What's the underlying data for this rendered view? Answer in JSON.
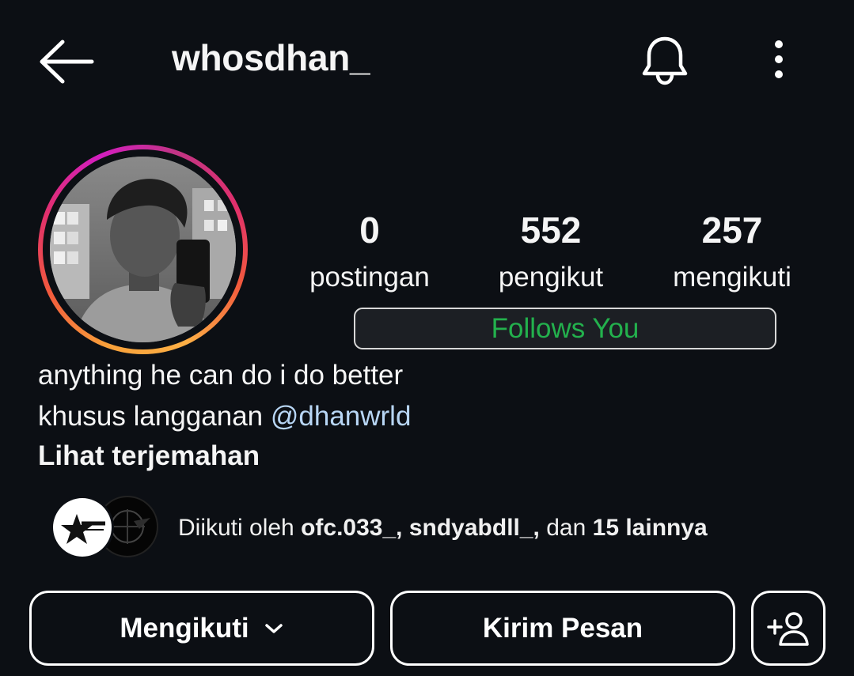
{
  "header": {
    "username": "whosdhan_",
    "back_icon": "arrow-left-icon",
    "notification_icon": "bell-icon",
    "menu_icon": "more-vertical-icon"
  },
  "profile": {
    "avatar_icon": "profile-photo",
    "story_ring_colors": [
      "#fcaf45",
      "#f25a3d",
      "#e1306c",
      "#c13584"
    ]
  },
  "stats": {
    "posts": {
      "value": "0",
      "label": "postingan"
    },
    "followers": {
      "value": "552",
      "label": "pengikut"
    },
    "following": {
      "value": "257",
      "label": "mengikuti"
    }
  },
  "follows_you": "Follows You",
  "bio": {
    "line1": "anything he can do i do better",
    "line2_prefix": "khusus langganan",
    "line2_mention": "@dhanwrld",
    "translate": "Lihat terjemahan"
  },
  "followed_by": {
    "prefix": "Diikuti oleh",
    "user1": "ofc.033_,",
    "user2": "sndyabdll_,",
    "conjunction": "dan",
    "others": "15 lainnya"
  },
  "actions": {
    "following": "Mengikuti",
    "message": "Kirim Pesan",
    "add_user_icon": "add-person-icon"
  },
  "colors": {
    "background": "#0c0f14",
    "follows_you_text": "#23b14d",
    "mention": "#b8d6f5"
  }
}
